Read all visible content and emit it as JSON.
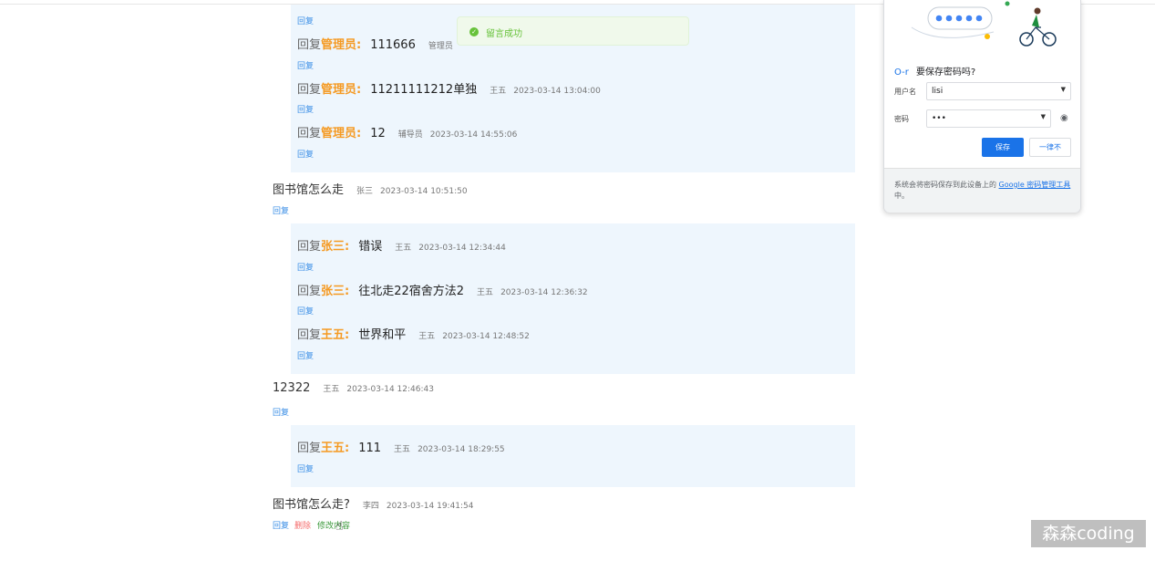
{
  "toast": {
    "icon": "check-circle-icon",
    "text": "留言成功"
  },
  "labels": {
    "reply": "回复",
    "delete": "删除",
    "edit": "修改内容",
    "reply_prefix": "回复"
  },
  "thread1_replies": [
    {
      "target": "管理员:",
      "content": "111666",
      "user": "管理员",
      "time": ""
    },
    {
      "target": "管理员:",
      "content": "11211111212单独",
      "user": "王五",
      "time": "2023-03-14 13:04:00"
    },
    {
      "target": "管理员:",
      "content": "12",
      "user": "辅导员",
      "time": "2023-03-14 14:55:06"
    }
  ],
  "message2": {
    "content": "图书馆怎么走",
    "user": "张三",
    "time": "2023-03-14 10:51:50"
  },
  "thread2_replies": [
    {
      "target": "张三:",
      "content": "错误",
      "user": "王五",
      "time": "2023-03-14 12:34:44"
    },
    {
      "target": "张三:",
      "content": "往北走22宿舍方法2",
      "user": "王五",
      "time": "2023-03-14 12:36:32"
    },
    {
      "target": "王五:",
      "content": "世界和平",
      "user": "王五",
      "time": "2023-03-14 12:48:52"
    }
  ],
  "message3": {
    "content": "12322",
    "user": "王五",
    "time": "2023-03-14 12:46:43"
  },
  "thread3_replies": [
    {
      "target": "王五:",
      "content": "111",
      "user": "王五",
      "time": "2023-03-14 18:29:55"
    }
  ],
  "message4": {
    "content": "图书馆怎么走?",
    "user": "李四",
    "time": "2023-03-14 19:41:54"
  },
  "password_popup": {
    "question": "要保存密码吗?",
    "username_label": "用户名",
    "username_value": "lisi",
    "password_label": "密码",
    "password_value": "•••",
    "save_button": "保存",
    "never_button": "一律不",
    "footer_text": "系统会将密码保存到此设备上的 ",
    "footer_link": "Google 密码管理工具",
    "footer_suffix": "中。",
    "accent_color": "#1a73e8"
  },
  "watermark": "森森coding"
}
